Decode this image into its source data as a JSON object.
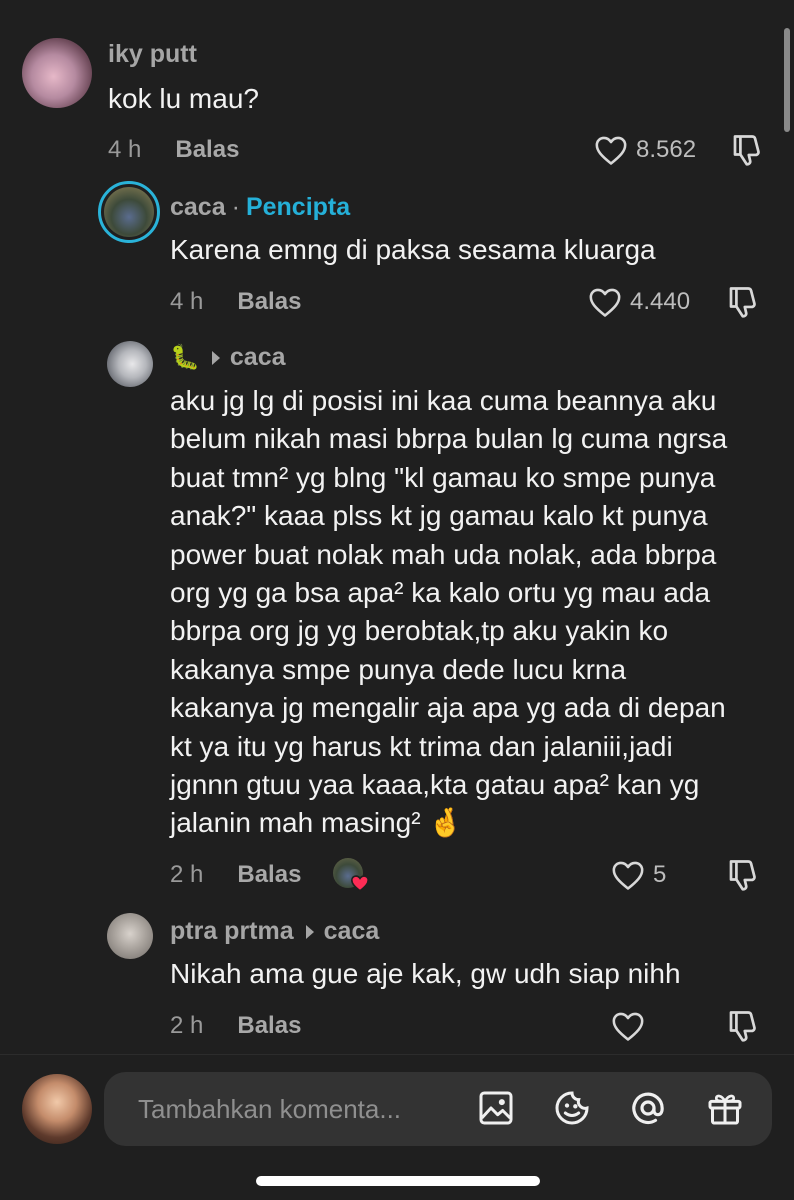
{
  "comments": [
    {
      "user": "iky putt",
      "text": [
        "kok lu mau?"
      ],
      "time": "4 h",
      "reply_label": "Balas",
      "likes": "8.562"
    },
    {
      "user": "caca",
      "separator": "·",
      "badge": "Pencipta",
      "text": [
        "Karena emng di paksa sesama kluarga"
      ],
      "time": "4 h",
      "reply_label": "Balas",
      "likes": "4.440"
    },
    {
      "user": "🐛",
      "reply_to": "caca",
      "text": [
        "aku jg lg di posisi ini kaa cuma beannya aku",
        "belum nikah masi bbrpa bulan lg cuma ngrsa",
        "buat tmn² yg blng \"kl gamau ko smpe punya",
        "anak?\" kaaa plss kt jg gamau kalo kt punya",
        "power buat nolak mah uda nolak, ada bbrpa",
        "org yg ga bsa apa² ka kalo ortu yg mau ada",
        "bbrpa org jg yg berobtak,tp aku yakin ko",
        "kakanya smpe punya dede lucu krna",
        "kakanya jg mengalir aja apa yg ada di depan",
        "kt ya itu yg harus kt trima dan jalaniii,jadi",
        "jgnnn gtuu yaa kaaa,kta gatau apa² kan yg",
        "jalanin mah masing² 🤞"
      ],
      "time": "2 h",
      "reply_label": "Balas",
      "likes": "5"
    },
    {
      "user": "ptra prtma",
      "reply_to": "caca",
      "text": [
        "Nikah ama gue aje kak, gw udh siap nihh"
      ],
      "time": "2 h",
      "reply_label": "Balas",
      "likes": ""
    }
  ],
  "composer": {
    "placeholder": "Tambahkan komenta...",
    "icons": [
      "image-icon",
      "emoji-icon",
      "mention-icon",
      "gift-icon"
    ]
  },
  "colors": {
    "background": "#1f1f1f",
    "creator_badge": "#25b0d8",
    "text": "#f2f2f2",
    "muted": "#a6a6a6"
  }
}
